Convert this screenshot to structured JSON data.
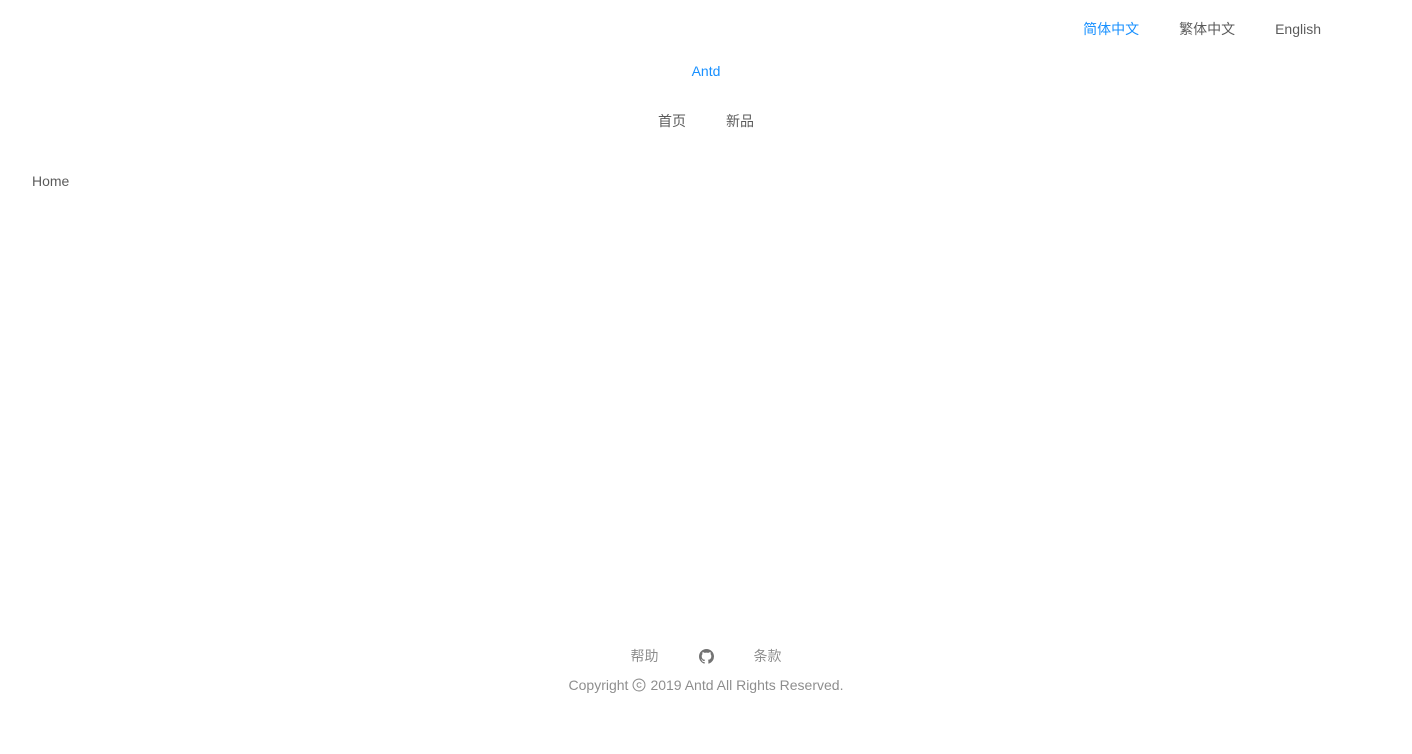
{
  "header": {
    "languages": [
      {
        "label": "简体中文",
        "active": true
      },
      {
        "label": "繁体中文",
        "active": false
      },
      {
        "label": "English",
        "active": false
      }
    ],
    "brand": "Antd",
    "nav": [
      "首页",
      "新品"
    ]
  },
  "breadcrumb": {
    "items": [
      "Home"
    ]
  },
  "footer": {
    "links": {
      "help": "帮助",
      "github_icon": "github-icon",
      "terms": "条款"
    },
    "copyright_prefix": "Copyright",
    "copyright_icon": "copyright-icon",
    "copyright_text": "2019 Antd All Rights Reserved."
  },
  "colors": {
    "accent": "#1890ff",
    "text": "rgba(0,0,0,0.65)",
    "muted": "rgba(0,0,0,0.45)"
  }
}
